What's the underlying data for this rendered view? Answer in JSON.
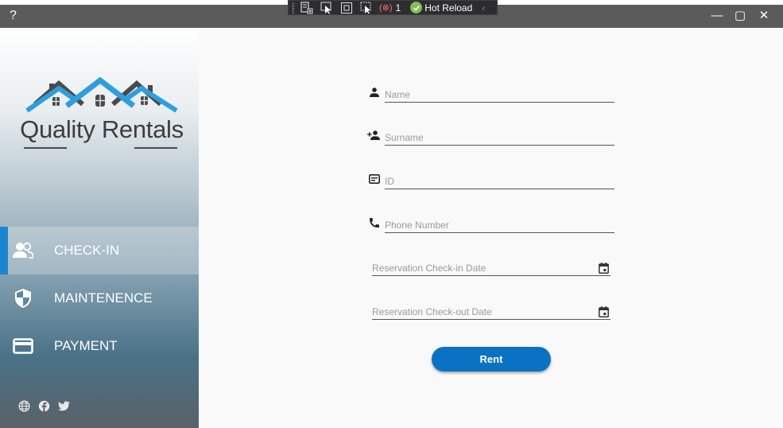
{
  "titlebar": {
    "help_label": "?",
    "min_label": "—",
    "max_label": "▢",
    "close_label": "✕"
  },
  "debug_toolbar": {
    "error_badge": "(⊗)",
    "error_count": "1",
    "hot_reload_label": "Hot Reload",
    "collapse_label": "‹"
  },
  "brand": {
    "name": "Quality Rentals",
    "colors": {
      "roof_blue": "#2e9ede",
      "roof_dark": "#4a4a4a"
    }
  },
  "sidebar": {
    "items": [
      {
        "label": "CHECK-IN",
        "icon": "people-icon",
        "active": true
      },
      {
        "label": "MAINTENENCE",
        "icon": "shield-icon",
        "active": false
      },
      {
        "label": "PAYMENT",
        "icon": "credit-card-icon",
        "active": false
      }
    ],
    "social": [
      "globe-icon",
      "facebook-icon",
      "twitter-icon"
    ],
    "accent": "#1b86cf"
  },
  "form": {
    "name": {
      "placeholder": "Name",
      "value": "",
      "icon": "person-icon"
    },
    "surname": {
      "placeholder": "Surname",
      "value": "",
      "icon": "person-add-icon"
    },
    "id": {
      "placeholder": "ID",
      "value": "",
      "icon": "id-card-icon"
    },
    "phone": {
      "placeholder": "Phone Number",
      "value": "",
      "icon": "phone-icon"
    },
    "checkin": {
      "placeholder": "Reservation Check-in Date",
      "value": "",
      "icon": "calendar-icon"
    },
    "checkout": {
      "placeholder": "Reservation Check-out Date",
      "value": "",
      "icon": "calendar-icon"
    },
    "submit_label": "Rent",
    "submit_color": "#0a72c3"
  }
}
